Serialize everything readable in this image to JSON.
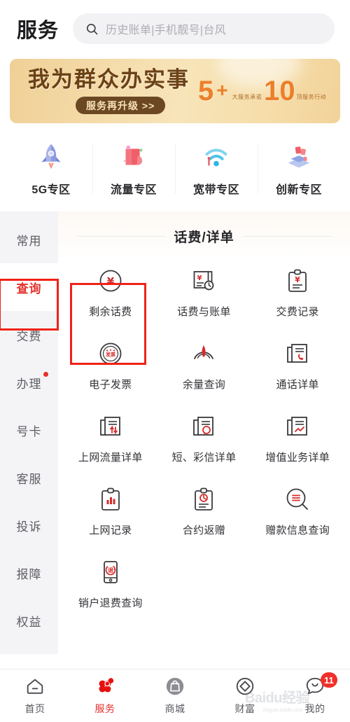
{
  "header": {
    "title": "服务",
    "search_icon": "search-icon",
    "search_placeholder": "历史账单|手机靓号|台风",
    "search_value": ""
  },
  "banner": {
    "title": "我为群众办实事",
    "button_label": "服务再升级 >>",
    "num_left": "5",
    "plus": "+",
    "num_right": "10",
    "sub_left": "大服务承诺",
    "sub_right": "顶服务行动",
    "accent_color": "#ec7f2a",
    "text_color": "#6b4115"
  },
  "quick_entries": [
    {
      "label": "5G专区",
      "icon": "rocket-icon"
    },
    {
      "label": "流量专区",
      "icon": "data-package-icon"
    },
    {
      "label": "宽带专区",
      "icon": "wifi-icon"
    },
    {
      "label": "创新专区",
      "icon": "innovation-cubes-icon"
    }
  ],
  "sidebar": {
    "items": [
      {
        "label": "常用",
        "active": false,
        "dot": false
      },
      {
        "label": "查询",
        "active": true,
        "dot": false
      },
      {
        "label": "交费",
        "active": false,
        "dot": false
      },
      {
        "label": "办理",
        "active": false,
        "dot": true
      },
      {
        "label": "号卡",
        "active": false,
        "dot": false
      },
      {
        "label": "客服",
        "active": false,
        "dot": false
      },
      {
        "label": "投诉",
        "active": false,
        "dot": false
      },
      {
        "label": "报障",
        "active": false,
        "dot": false
      },
      {
        "label": "权益",
        "active": false,
        "dot": false
      }
    ],
    "active_color": "#e4322b"
  },
  "content": {
    "section_title": "话费/详单",
    "items": [
      {
        "label": "剩余话费",
        "icon": "yen-circle-icon",
        "highlighted": true
      },
      {
        "label": "话费与账单",
        "icon": "bill-clock-icon",
        "highlighted": false
      },
      {
        "label": "交费记录",
        "icon": "clipboard-yen-icon",
        "highlighted": false
      },
      {
        "label": "电子发票",
        "icon": "e-invoice-icon",
        "highlighted": false
      },
      {
        "label": "余量查询",
        "icon": "gauge-icon",
        "highlighted": false
      },
      {
        "label": "通话详单",
        "icon": "doc-phone-icon",
        "highlighted": false
      },
      {
        "label": "上网流量详单",
        "icon": "doc-data-arrows-icon",
        "highlighted": false
      },
      {
        "label": "短、彩信详单",
        "icon": "doc-message-icon",
        "highlighted": false
      },
      {
        "label": "增值业务详单",
        "icon": "doc-chart-icon",
        "highlighted": false
      },
      {
        "label": "上网记录",
        "icon": "clipboard-bars-icon",
        "highlighted": false
      },
      {
        "label": "合约返赠",
        "icon": "clipboard-contract-icon",
        "highlighted": false
      },
      {
        "label": "赠款信息查询",
        "icon": "search-list-icon",
        "highlighted": false
      },
      {
        "label": "销户退费查询",
        "icon": "phone-refund-icon",
        "highlighted": false
      }
    ],
    "annotation_color": "#f02217"
  },
  "bottom_nav": {
    "items": [
      {
        "label": "首页",
        "icon": "home-icon",
        "active": false,
        "badge": ""
      },
      {
        "label": "服务",
        "icon": "clover-icon",
        "active": true,
        "badge": ""
      },
      {
        "label": "商城",
        "icon": "shop-bag-icon",
        "active": false,
        "badge": ""
      },
      {
        "label": "财富",
        "icon": "diamond-icon",
        "active": false,
        "badge": ""
      },
      {
        "label": "我的",
        "icon": "smiley-icon",
        "active": false,
        "badge": "11"
      }
    ]
  },
  "watermark": {
    "text": "Baidu经验",
    "sub": "jingyan.baidu.com"
  }
}
